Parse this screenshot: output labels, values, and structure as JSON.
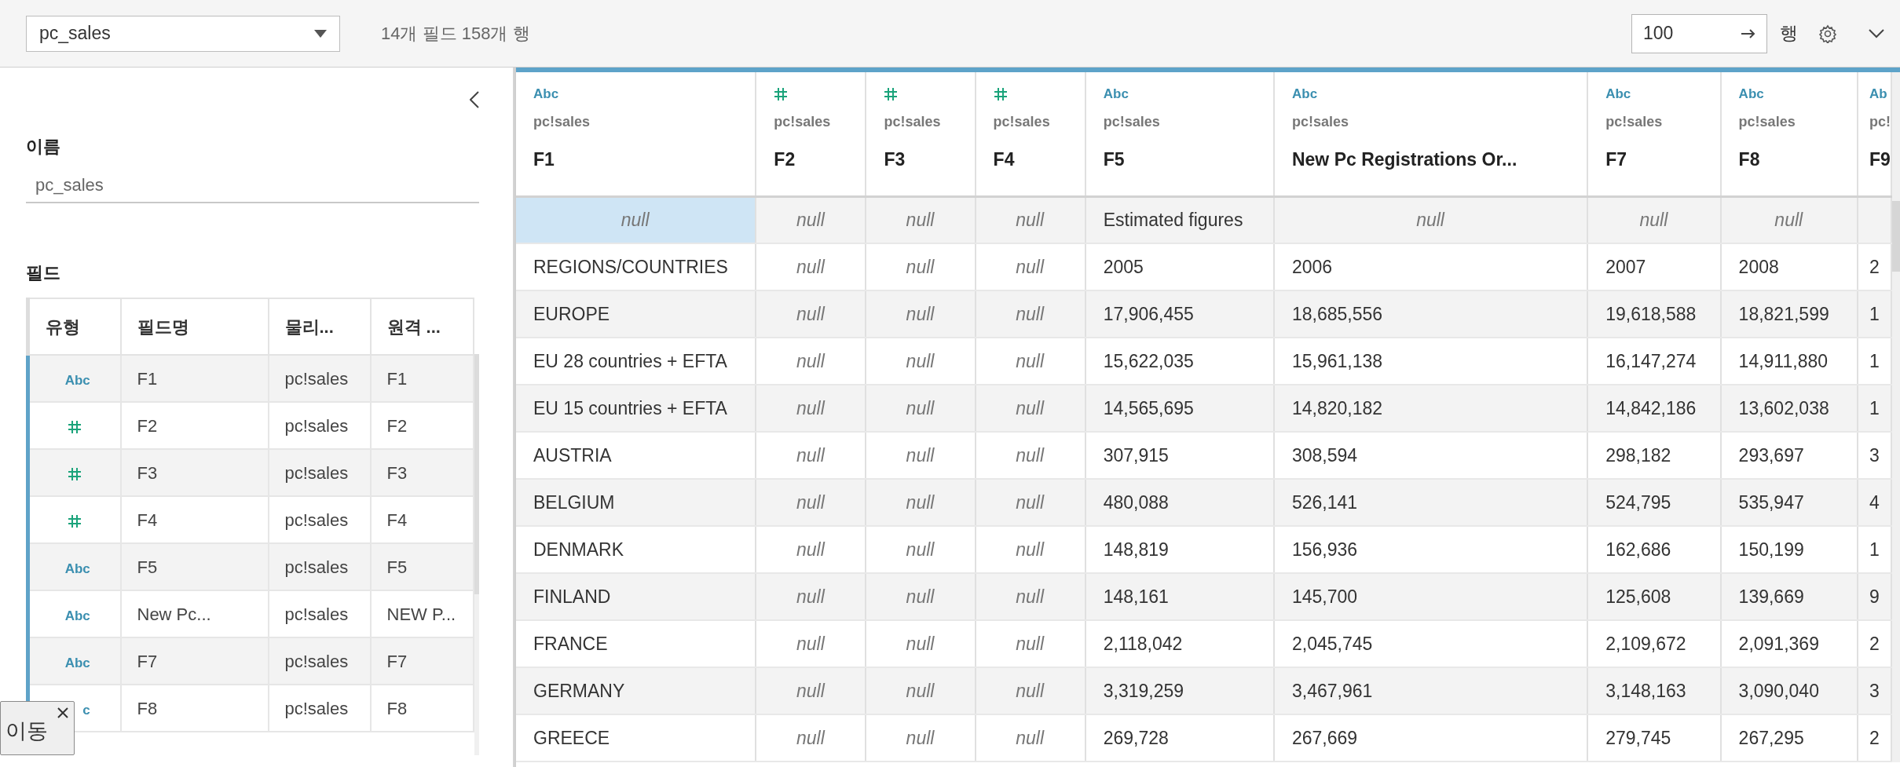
{
  "toolbar": {
    "source": "pc_sales",
    "summary": "14개 필드 158개 행",
    "row_limit": "100",
    "rows_label": "행"
  },
  "side_panel": {
    "name_label": "이름",
    "name_value": "pc_sales",
    "fields_label": "필드",
    "columns": [
      "유형",
      "필드명",
      "물리...",
      "원격 ..."
    ],
    "fields": [
      {
        "kind": "string",
        "type_label": "Abc",
        "name": "F1",
        "physical": "pc!sales",
        "remote": "F1"
      },
      {
        "kind": "number",
        "name": "F2",
        "physical": "pc!sales",
        "remote": "F2"
      },
      {
        "kind": "number",
        "name": "F3",
        "physical": "pc!sales",
        "remote": "F3"
      },
      {
        "kind": "number",
        "name": "F4",
        "physical": "pc!sales",
        "remote": "F4"
      },
      {
        "kind": "string",
        "type_label": "Abc",
        "name": "F5",
        "physical": "pc!sales",
        "remote": "F5"
      },
      {
        "kind": "string",
        "type_label": "Abc",
        "name": "New Pc...",
        "physical": "pc!sales",
        "remote": "NEW P..."
      },
      {
        "kind": "string",
        "type_label": "Abc",
        "name": "F7",
        "physical": "pc!sales",
        "remote": "F7"
      },
      {
        "kind": "string",
        "type_label": "c",
        "name": "F8",
        "physical": "pc!sales",
        "remote": "F8"
      }
    ]
  },
  "grid": {
    "columns": [
      {
        "kind": "string",
        "type_label": "Abc",
        "source": "pc!sales",
        "name": "F1"
      },
      {
        "kind": "number",
        "source": "pc!sales",
        "name": "F2"
      },
      {
        "kind": "number",
        "source": "pc!sales",
        "name": "F3"
      },
      {
        "kind": "number",
        "source": "pc!sales",
        "name": "F4"
      },
      {
        "kind": "string",
        "type_label": "Abc",
        "source": "pc!sales",
        "name": "F5"
      },
      {
        "kind": "string",
        "type_label": "Abc",
        "source": "pc!sales",
        "name": "New Pc Registrations Or..."
      },
      {
        "kind": "string",
        "type_label": "Abc",
        "source": "pc!sales",
        "name": "F7"
      },
      {
        "kind": "string",
        "type_label": "Abc",
        "source": "pc!sales",
        "name": "F8"
      },
      {
        "kind": "string",
        "type_label": "Ab",
        "source": "pc!",
        "name": "F9"
      }
    ],
    "rows": [
      [
        {
          "text": "null",
          "null": true,
          "selected": true
        },
        {
          "text": "null",
          "null": true
        },
        {
          "text": "null",
          "null": true
        },
        {
          "text": "null",
          "null": true
        },
        "Estimated figures",
        {
          "text": "null",
          "null": true
        },
        {
          "text": "null",
          "null": true
        },
        {
          "text": "null",
          "null": true
        },
        null
      ],
      [
        "REGIONS/COUNTRIES",
        {
          "text": "null",
          "null": true
        },
        {
          "text": "null",
          "null": true
        },
        {
          "text": "null",
          "null": true
        },
        "2005",
        "2006",
        "2007",
        "2008",
        "2"
      ],
      [
        "EUROPE",
        {
          "text": "null",
          "null": true
        },
        {
          "text": "null",
          "null": true
        },
        {
          "text": "null",
          "null": true
        },
        "17,906,455",
        "18,685,556",
        "19,618,588",
        "18,821,599",
        "1"
      ],
      [
        "EU 28 countries + EFTA",
        {
          "text": "null",
          "null": true
        },
        {
          "text": "null",
          "null": true
        },
        {
          "text": "null",
          "null": true
        },
        "15,622,035",
        "15,961,138",
        "16,147,274",
        "14,911,880",
        "1"
      ],
      [
        "EU 15 countries + EFTA",
        {
          "text": "null",
          "null": true
        },
        {
          "text": "null",
          "null": true
        },
        {
          "text": "null",
          "null": true
        },
        "14,565,695",
        "14,820,182",
        "14,842,186",
        "13,602,038",
        "1"
      ],
      [
        "AUSTRIA",
        {
          "text": "null",
          "null": true
        },
        {
          "text": "null",
          "null": true
        },
        {
          "text": "null",
          "null": true
        },
        "307,915",
        "308,594",
        "298,182",
        "293,697",
        "3"
      ],
      [
        "BELGIUM",
        {
          "text": "null",
          "null": true
        },
        {
          "text": "null",
          "null": true
        },
        {
          "text": "null",
          "null": true
        },
        "480,088",
        "526,141",
        "524,795",
        "535,947",
        "4"
      ],
      [
        "DENMARK",
        {
          "text": "null",
          "null": true
        },
        {
          "text": "null",
          "null": true
        },
        {
          "text": "null",
          "null": true
        },
        "148,819",
        "156,936",
        "162,686",
        "150,199",
        "1"
      ],
      [
        "FINLAND",
        {
          "text": "null",
          "null": true
        },
        {
          "text": "null",
          "null": true
        },
        {
          "text": "null",
          "null": true
        },
        "148,161",
        "145,700",
        "125,608",
        "139,669",
        "9"
      ],
      [
        "FRANCE",
        {
          "text": "null",
          "null": true
        },
        {
          "text": "null",
          "null": true
        },
        {
          "text": "null",
          "null": true
        },
        "2,118,042",
        "2,045,745",
        "2,109,672",
        "2,091,369",
        "2"
      ],
      [
        "GERMANY",
        {
          "text": "null",
          "null": true
        },
        {
          "text": "null",
          "null": true
        },
        {
          "text": "null",
          "null": true
        },
        "3,319,259",
        "3,467,961",
        "3,148,163",
        "3,090,040",
        "3"
      ],
      [
        "GREECE",
        {
          "text": "null",
          "null": true
        },
        {
          "text": "null",
          "null": true
        },
        {
          "text": "null",
          "null": true
        },
        "269,728",
        "267,669",
        "279,745",
        "267,295",
        "2"
      ]
    ]
  },
  "tooltip": {
    "text": "이동"
  }
}
